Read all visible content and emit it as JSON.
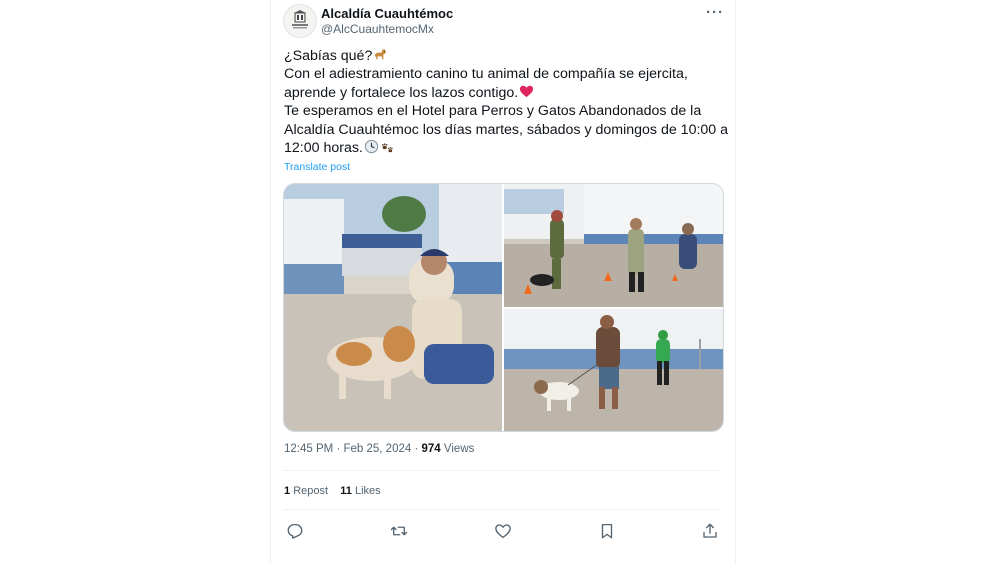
{
  "tweet": {
    "author_name": "Alcaldía Cuauhtémoc",
    "author_handle": "@AlcCuauhtemocMx",
    "avatar_icon": "city-hall-logo-icon",
    "more_icon": "more-options-icon",
    "more_label": "···",
    "text_lines": [
      "¿Sabías qué?",
      "Con el adiestramiento canino tu animal de compañía se ejercita,",
      "aprende y fortalece los lazos contigo.",
      "Te esperamos en el Hotel para Perros y Gatos Abandonados de la",
      "Alcaldía Cuauhtémoc los días martes, sábados y domingos de 10:00 a",
      "12:00 horas."
    ],
    "emojis": [
      "dog-emoji",
      "red-heart-emoji",
      "clock-emoji",
      "paw-prints-emoji"
    ],
    "translate_label": "Translate post",
    "time": "12:45 PM",
    "separator": "·",
    "date": "Feb 25, 2024",
    "views_count": "974",
    "views_label": "Views",
    "reposts_count": "1",
    "reposts_label": "Repost",
    "likes_count": "11",
    "likes_label": "Likes"
  },
  "media": [
    {
      "name": "photo-dog-training-courtyard"
    },
    {
      "name": "photo-trainers-with-dogs"
    },
    {
      "name": "photo-man-walking-dog"
    }
  ],
  "actions": [
    {
      "name": "reply-button",
      "icon": "reply-icon"
    },
    {
      "name": "repost-button",
      "icon": "repost-icon"
    },
    {
      "name": "like-button",
      "icon": "heart-icon"
    },
    {
      "name": "bookmark-button",
      "icon": "bookmark-icon"
    },
    {
      "name": "share-button",
      "icon": "share-icon"
    }
  ],
  "colors": {
    "link": "#1d9bf0",
    "secondary_text": "#536471",
    "primary_text": "#0f1419",
    "heart_emoji": "#e0245e"
  }
}
